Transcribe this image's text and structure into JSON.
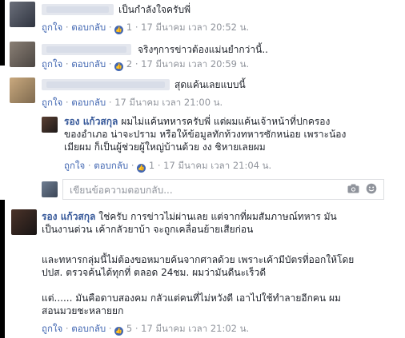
{
  "comments": [
    {
      "text": "เป็นกำลังใจครับพี่",
      "actions": {
        "like": "ถูกใจ",
        "reply": "ตอบกลับ",
        "likes": "1",
        "time": "17 มีนาคม เวลา 20:52 น."
      }
    },
    {
      "text": "จริงๆการข่าวต้องแม่นยำกว่านี้..",
      "actions": {
        "like": "ถูกใจ",
        "reply": "ตอบกลับ",
        "likes": "2",
        "time": "17 มีนาคม เวลา 20:59 น."
      }
    },
    {
      "text": "สุดแค้นเลยแบบนี้",
      "actions": {
        "like": "ถูกใจ",
        "reply": "ตอบกลับ",
        "time": "17 มีนาคม เวลา 21:00 น."
      }
    }
  ],
  "reply": {
    "author": "รอง แก้วสกุล",
    "line1": "ผมไม่แค้นทหารครับพี่ แต่ผมแค้นเจ้าหน้าที่ปกครอง",
    "line2": "ของอำเภอ น่าจะปราม หรือให้ข้อมูลทักท้วงทหารซักหน่อย เพราะน้อง",
    "line3": "เมียผม ก็เป็นผู้ช่วยผู้ใหญ่บ้านด้วย งง ชิหายเลยผม",
    "actions": {
      "like": "ถูกใจ",
      "reply": "ตอบกลับ",
      "likes": "1",
      "time": "17 มีนาคม เวลา 21:04 น."
    }
  },
  "reply_input": {
    "placeholder": "เขียนข้อความตอบกลับ..."
  },
  "main_comment": {
    "author": "รอง แก้วสกุล",
    "p1_line1": "ใช่ครับ การข่าวไม่ผ่านเลย แต่จากที่ผมสัมภาษณ์ทหาร มัน",
    "p1_line2": "เป็นงานด่วน เค้ากลัวยาบ้า จะถูกเคลื่อนย้ายเสียก่อน",
    "p2_line1": "และทหารกลุ่มนี้ไม่ต้องขอหมายค้นจากศาลด้วย เพราะเค้ามีบัตรที่ออกให้โดย",
    "p2_line2": "ปปส. ตรวจค้นได้ทุกที่ ตลอด 24ชม. ผมว่ามันดีนะเร็วดี",
    "p3_line1": "แต่...... มันคือดาบสองคม กลัวแต่คนที่ไม่หวังดี เอาไปใช้ทำลายอีกคน ผม",
    "p3_line2": "สอนมวยชะหลายยก",
    "actions": {
      "like": "ถูกใจ",
      "reply": "ตอบกลับ",
      "likes": "5",
      "time": "17 มีนาคม เวลา 21:02 น."
    }
  },
  "colors": {
    "link": "#4267b2",
    "name": "#365899",
    "meta": "#90949c",
    "text": "#1d2129"
  },
  "icons": [
    "camera-icon",
    "emoji-icon",
    "like-reaction-icon"
  ]
}
